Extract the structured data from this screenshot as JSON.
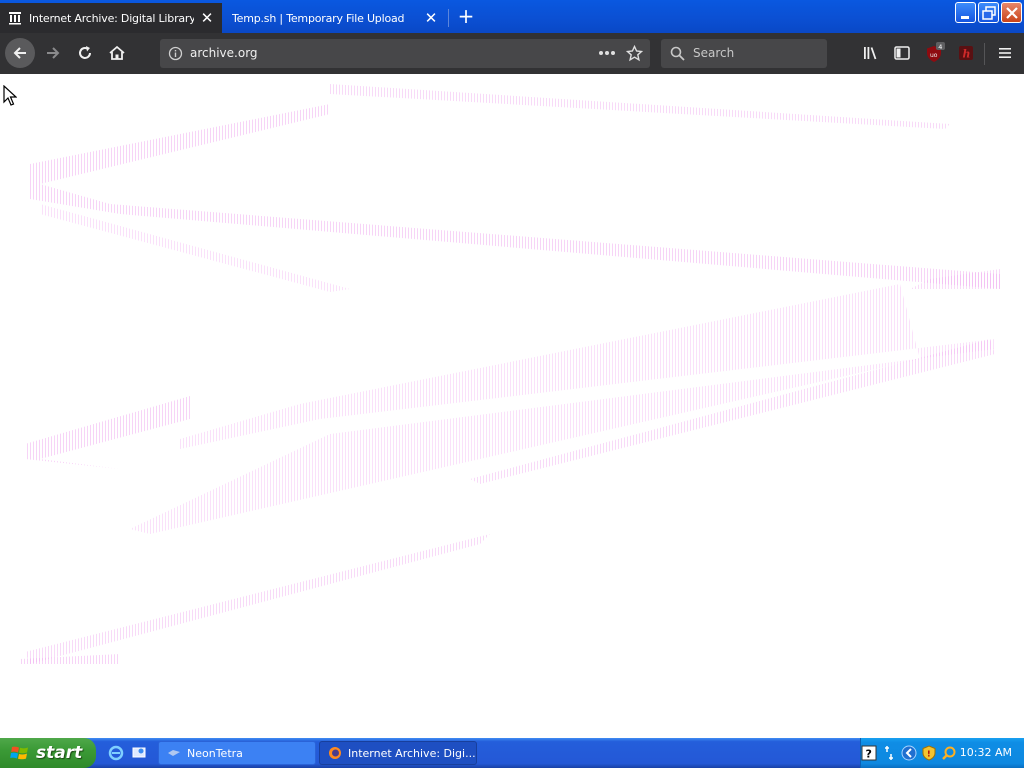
{
  "browser": {
    "tabs": [
      {
        "title": "Internet Archive: Digital Library of",
        "active": true,
        "icon": "archive-building-icon"
      },
      {
        "title": "Temp.sh | Temporary File Upload",
        "active": false,
        "icon": ""
      }
    ],
    "url": "archive.org",
    "search_placeholder": "Search",
    "ublock_badge": "4"
  },
  "taskbar": {
    "start_label": "start",
    "buttons": [
      {
        "label": "NeonTetra",
        "active": false
      },
      {
        "label": "Internet Archive: Digi...",
        "active": true
      }
    ],
    "clock": "10:32 AM"
  },
  "colors": {
    "tab_strip": "#0b4fd2",
    "nav_bar": "#323234",
    "url_bar": "#474749",
    "taskbar": "#2458d6",
    "start_button": "#3b9a36",
    "tray": "#0f8de5"
  }
}
